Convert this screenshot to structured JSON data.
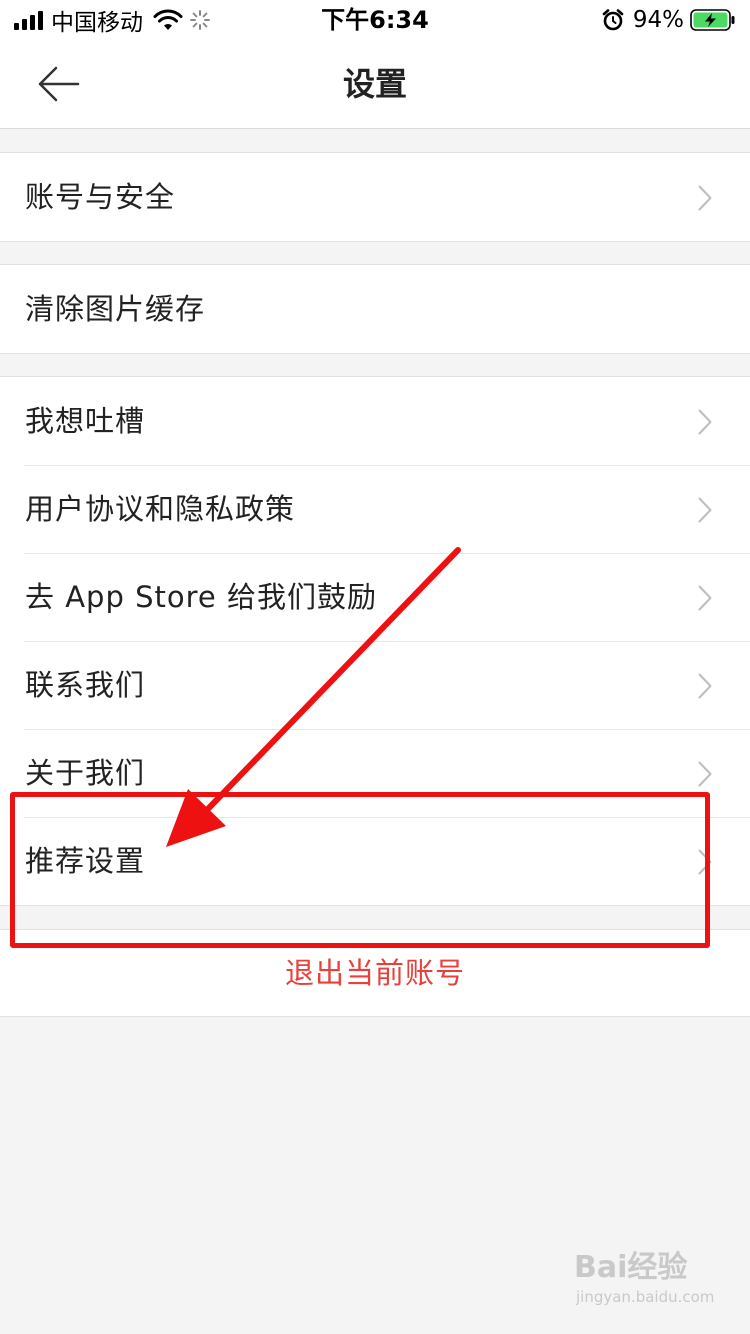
{
  "status_bar": {
    "carrier": "中国移动",
    "time": "下午6:34",
    "battery": "94%"
  },
  "nav": {
    "title": "设置"
  },
  "groups": [
    {
      "items": [
        {
          "label": "账号与安全",
          "has_chevron": true
        }
      ]
    },
    {
      "items": [
        {
          "label": "清除图片缓存",
          "has_chevron": false
        }
      ]
    },
    {
      "items": [
        {
          "label": "我想吐槽",
          "has_chevron": true
        },
        {
          "label": "用户协议和隐私政策",
          "has_chevron": true
        },
        {
          "label": "去 App Store 给我们鼓励",
          "has_chevron": true
        },
        {
          "label": "联系我们",
          "has_chevron": true
        },
        {
          "label": "关于我们",
          "has_chevron": true
        },
        {
          "label": "推荐设置",
          "has_chevron": true
        }
      ]
    }
  ],
  "logout": {
    "label": "退出当前账号",
    "color": "#e8403a"
  },
  "annotation": {
    "color": "#ee1111",
    "target": "推荐设置"
  },
  "watermark": {
    "text": "Bai经验",
    "sub": "jingyan.baidu.com"
  }
}
